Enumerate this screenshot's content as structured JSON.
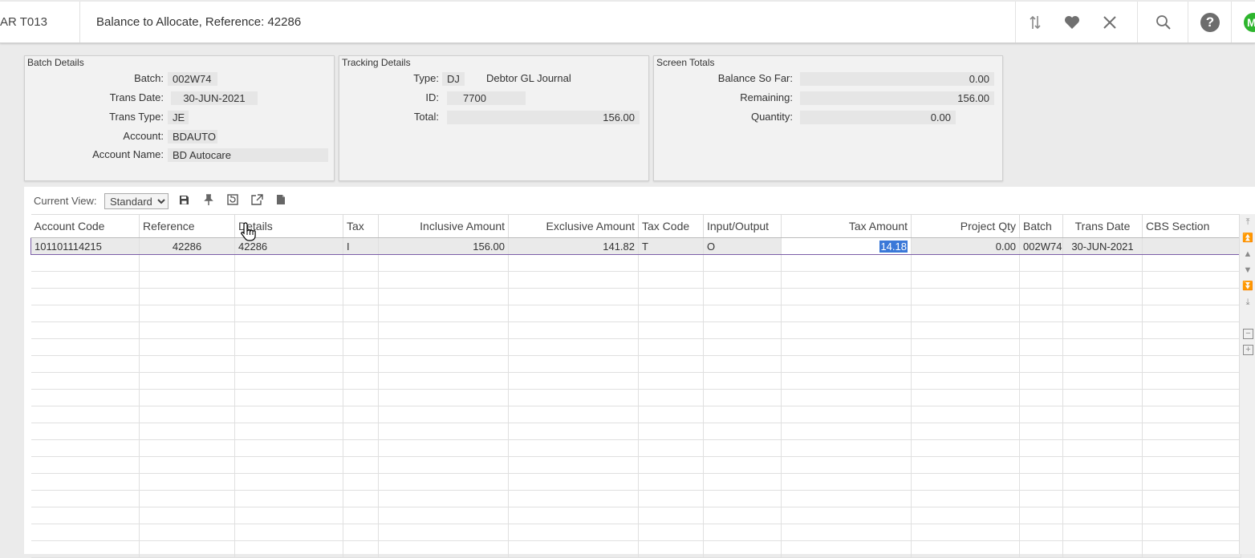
{
  "header": {
    "code": "AR T013",
    "title": "Balance to Allocate, Reference: 42286",
    "avatar_letter": "M"
  },
  "panels": {
    "batch": {
      "title": "Batch Details",
      "batch_label": "Batch:",
      "batch_value": "002W74",
      "trans_date_label": "Trans Date:",
      "trans_date_value": "30-JUN-2021",
      "trans_type_label": "Trans Type:",
      "trans_type_value": "JE",
      "account_label": "Account:",
      "account_value": "BDAUTO",
      "account_name_label": "Account Name:",
      "account_name_value": "BD Autocare"
    },
    "tracking": {
      "title": "Tracking Details",
      "type_label": "Type:",
      "type_code": "DJ",
      "type_desc": "Debtor GL Journal",
      "id_label": "ID:",
      "id_value": "7700",
      "total_label": "Total:",
      "total_value": "156.00"
    },
    "totals": {
      "title": "Screen Totals",
      "balance_label": "Balance So Far:",
      "balance_value": "0.00",
      "remaining_label": "Remaining:",
      "remaining_value": "156.00",
      "quantity_label": "Quantity:",
      "quantity_value": "0.00"
    }
  },
  "toolbar": {
    "current_view_label": "Current View:",
    "view_selected": "Standard"
  },
  "grid": {
    "columns": [
      "Account Code",
      "Reference",
      "Details",
      "Tax",
      "Inclusive Amount",
      "Exclusive Amount",
      "Tax Code",
      "Input/Output",
      "Tax Amount",
      "Project Qty",
      "Batch",
      "Trans Date",
      "CBS Section"
    ],
    "row": {
      "account_code": "101101114215",
      "reference": "42286",
      "details": "42286",
      "tax": "I",
      "inclusive_amount": "156.00",
      "exclusive_amount": "141.82",
      "tax_code": "T",
      "input_output": "O",
      "tax_amount": "14.18",
      "project_qty": "0.00",
      "batch": "002W74",
      "trans_date": "30-JUN-2021",
      "cbs_section": ""
    }
  }
}
